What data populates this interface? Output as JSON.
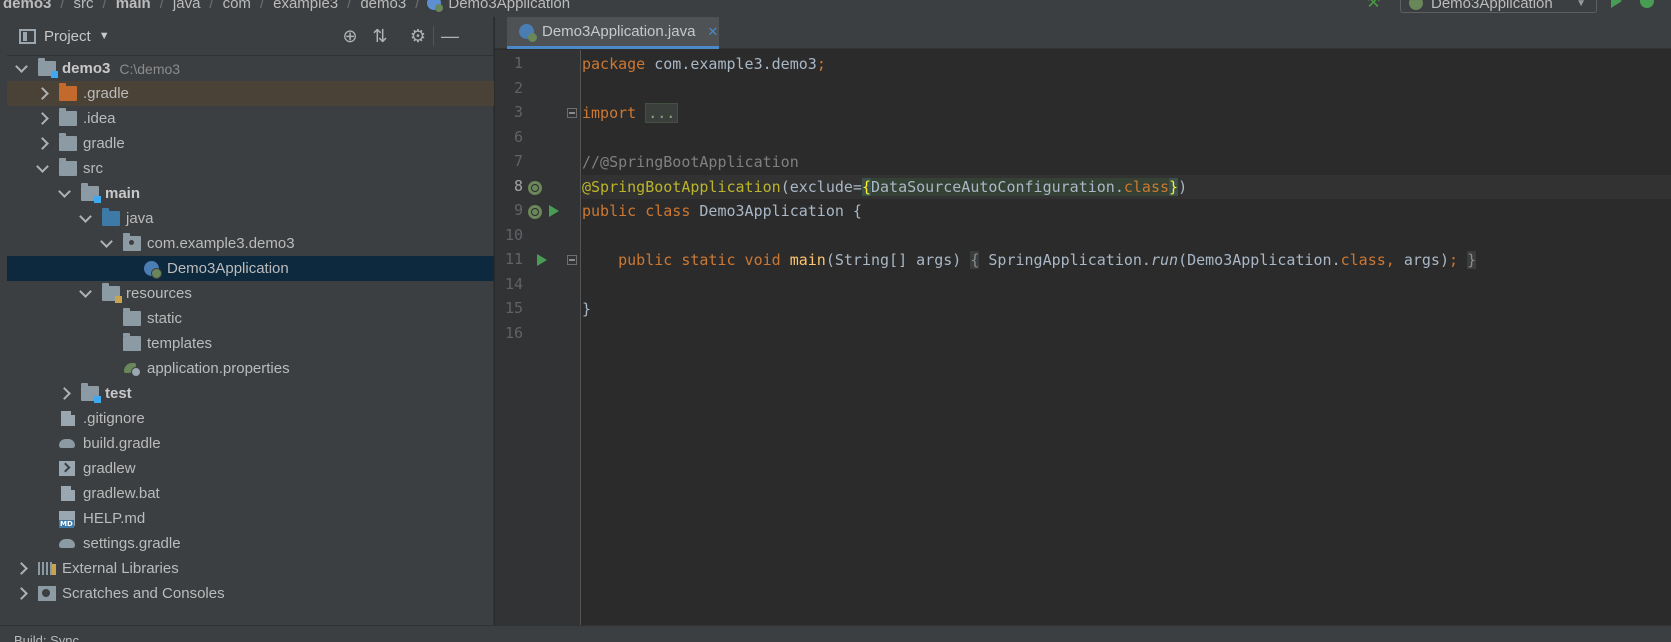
{
  "breadcrumb": [
    "demo3",
    "src",
    "main",
    "java",
    "com",
    "example3",
    "demo3",
    "Demo3Application"
  ],
  "run_config": {
    "label": "Demo3Application"
  },
  "project_panel": {
    "title": "Project",
    "tree": [
      {
        "label": "demo3",
        "path": "C:\\demo3",
        "depth": 0,
        "expanded": true,
        "icon": "project-folder-icon"
      },
      {
        "label": ".gradle",
        "depth": 1,
        "expanded": false,
        "icon": "excluded-folder-icon"
      },
      {
        "label": ".idea",
        "depth": 1,
        "expanded": false,
        "icon": "folder-icon"
      },
      {
        "label": "gradle",
        "depth": 1,
        "expanded": false,
        "icon": "folder-icon"
      },
      {
        "label": "src",
        "depth": 1,
        "expanded": true,
        "icon": "folder-icon"
      },
      {
        "label": "main",
        "depth": 2,
        "expanded": true,
        "icon": "module-folder-icon"
      },
      {
        "label": "java",
        "depth": 3,
        "expanded": true,
        "icon": "source-folder-icon"
      },
      {
        "label": "com.example3.demo3",
        "depth": 4,
        "expanded": true,
        "icon": "package-icon"
      },
      {
        "label": "Demo3Application",
        "depth": 5,
        "icon": "spring-class-icon"
      },
      {
        "label": "resources",
        "depth": 3,
        "expanded": true,
        "icon": "resources-folder-icon"
      },
      {
        "label": "static",
        "depth": 4,
        "icon": "folder-icon"
      },
      {
        "label": "templates",
        "depth": 4,
        "icon": "folder-icon"
      },
      {
        "label": "application.properties",
        "depth": 4,
        "icon": "spring-properties-icon"
      },
      {
        "label": "test",
        "depth": 2,
        "expanded": false,
        "icon": "module-folder-icon"
      },
      {
        "label": ".gitignore",
        "depth": 1,
        "icon": "text-file-icon"
      },
      {
        "label": "build.gradle",
        "depth": 1,
        "icon": "gradle-icon"
      },
      {
        "label": "gradlew",
        "depth": 1,
        "icon": "terminal-file-icon"
      },
      {
        "label": "gradlew.bat",
        "depth": 1,
        "icon": "text-file-icon"
      },
      {
        "label": "HELP.md",
        "depth": 1,
        "icon": "markdown-file-icon"
      },
      {
        "label": "settings.gradle",
        "depth": 1,
        "icon": "gradle-icon"
      },
      {
        "label": "External Libraries",
        "depth": 0,
        "expanded": false,
        "icon": "libraries-icon"
      },
      {
        "label": "Scratches and Consoles",
        "depth": 0,
        "expanded": false,
        "icon": "scratches-icon"
      }
    ]
  },
  "editor": {
    "tab_label": "Demo3Application.java",
    "line_numbers": [
      "1",
      "2",
      "3",
      "6",
      "7",
      "8",
      "9",
      "10",
      "11",
      "14",
      "15",
      "16"
    ],
    "code": {
      "l1_kw": "package",
      "l1_rest": " com.example3.demo3",
      "l1_semi": ";",
      "l3_kw": "import",
      "l3_fold": "...",
      "l7_comment": "//@SpringBootApplication",
      "l8_ann": "@SpringBootApplication",
      "l8_open": "(exclude=",
      "l8_lbrace": "{",
      "l8_cls": "DataSourceAutoConfiguration.",
      "l8_classkw": "class",
      "l8_rbrace": "}",
      "l8_close": ")",
      "l9_kw": "public class",
      "l9_name": " Demo3Application {",
      "l11_indent": "    ",
      "l11_kw": "public static void",
      "l11_sp": " ",
      "l11_fn": "main",
      "l11_params": "(String[] args) ",
      "l11_fold_open": "{",
      "l11_call": " SpringApplication.",
      "l11_run": "run",
      "l11_args": "(Demo3Application.",
      "l11_classkw": "class",
      "l11_comma": ",",
      "l11_args2": " args)",
      "l11_semi": ";",
      "l11_fold_close": "}",
      "l15": "}"
    }
  },
  "bottom": {
    "label": "Build:   Sync"
  }
}
